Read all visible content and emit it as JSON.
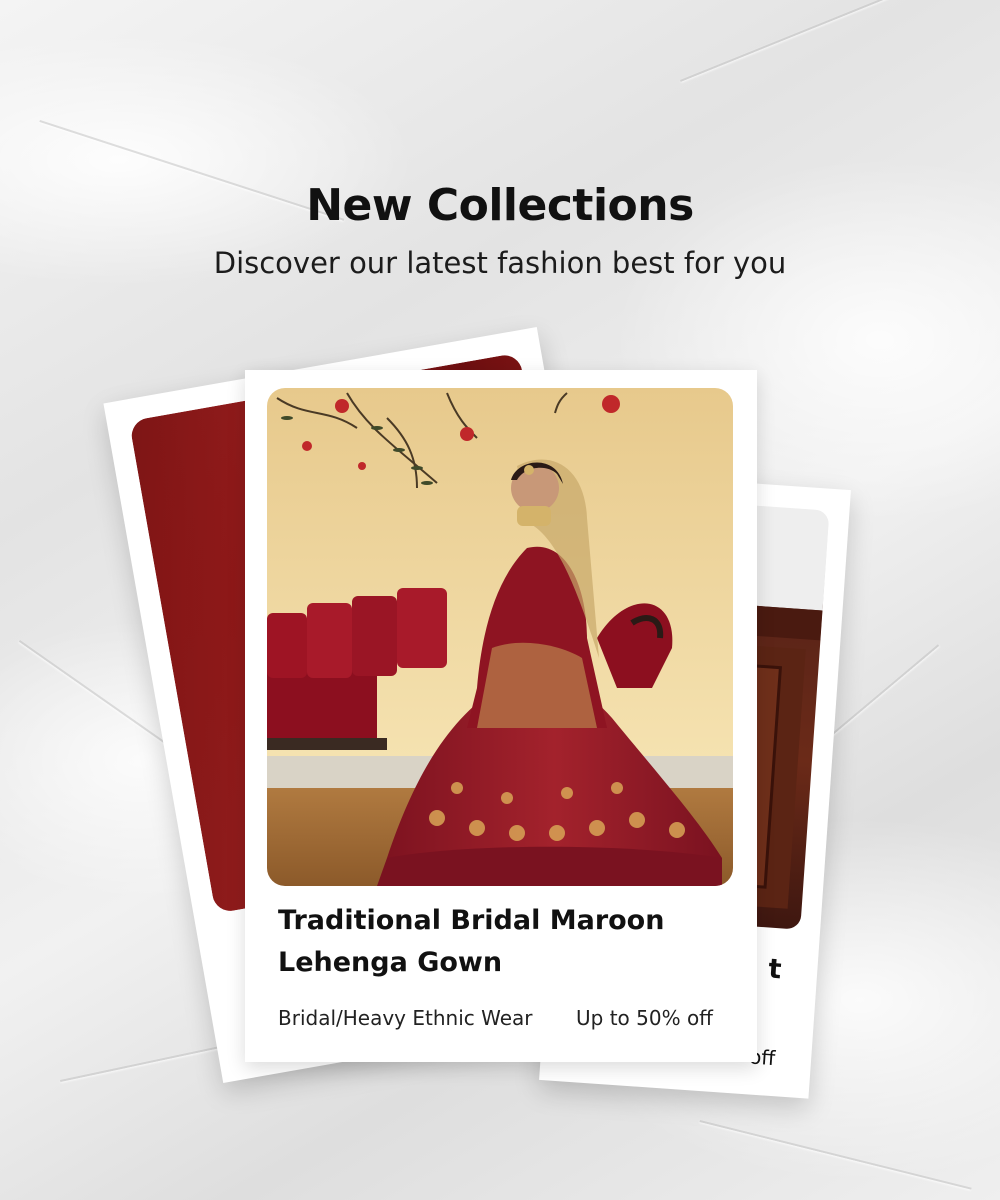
{
  "header": {
    "title": "New Collections",
    "subtitle": "Discover our latest fashion best for you"
  },
  "featured_card": {
    "title": "Traditional Bridal Maroon Lehenga Gown",
    "category": "Bridal/Heavy Ethnic Wear",
    "discount": "Up to 50% off",
    "image": "bride-in-maroon-lehenga-photo"
  },
  "back_cards": {
    "left_image": "maroon-fabric-photo",
    "right_image": "wooden-cabinet-photo",
    "right_title_fragment": "t",
    "right_discount_fragment": "off"
  },
  "colors": {
    "maroon": "#8a1a22",
    "wall": "#f3dea6",
    "gold": "#c9a25a",
    "text": "#111111"
  }
}
